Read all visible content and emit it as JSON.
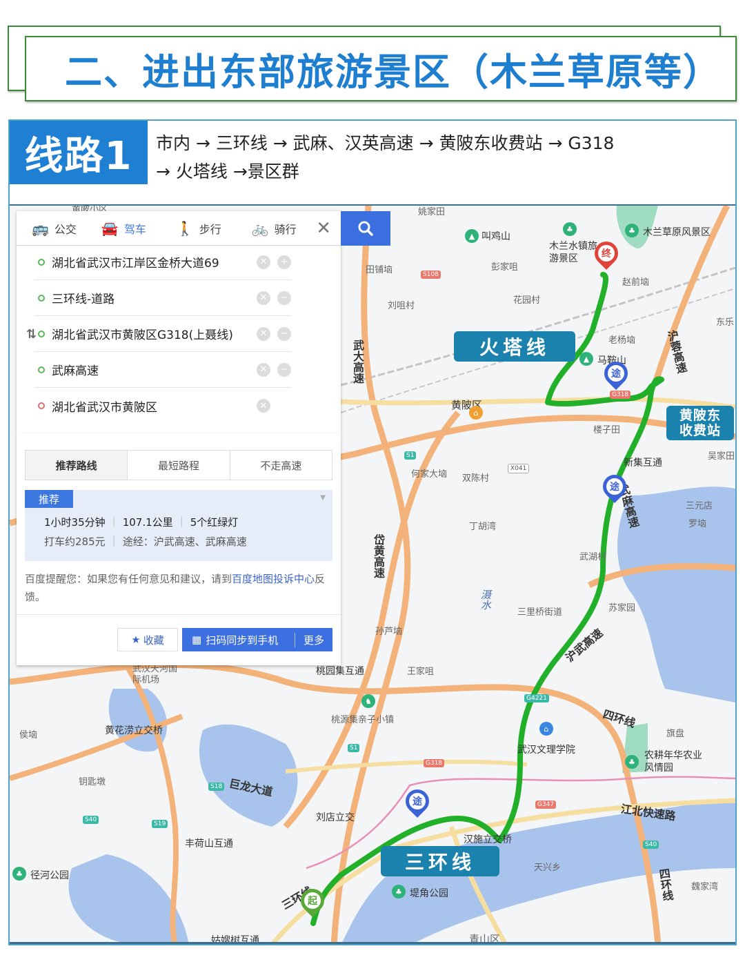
{
  "header": {
    "title": "二、进出东部旅游景区（木兰草原等）"
  },
  "route": {
    "badge": "线路1",
    "description_line1": "市内 → 三环线 → 武麻、汉英高速 → 黄陂东收费站 → G318",
    "description_line2": "→ 火塔线 →景区群"
  },
  "colors": {
    "title_blue": "#1e7fd0",
    "badge_blue": "#1f7fd2",
    "route_green": "#22b02a",
    "callout_teal": "#1a82ad",
    "baidu_blue": "#3c6fe0"
  },
  "directions_panel": {
    "tabs": [
      {
        "label": "公交",
        "icon": "bus-icon"
      },
      {
        "label": "驾车",
        "icon": "car-icon",
        "active": true
      },
      {
        "label": "步行",
        "icon": "walk-icon"
      },
      {
        "label": "骑行",
        "icon": "bike-icon"
      }
    ],
    "waypoints": [
      {
        "text": "湖北省武汉市江岸区金桥大道69",
        "type": "start",
        "action": "add"
      },
      {
        "text": "三环线-道路",
        "type": "via",
        "action": "remove"
      },
      {
        "text": "湖北省武汉市黄陂区G318(上聂线)",
        "type": "via",
        "action": "remove"
      },
      {
        "text": "武麻高速",
        "type": "via",
        "action": "remove"
      },
      {
        "text": "湖北省武汉市黄陂区",
        "type": "end"
      }
    ],
    "preferences": [
      "推荐路线",
      "最短路程",
      "不走高速"
    ],
    "result": {
      "tag": "推荐",
      "duration": "1小时35分钟",
      "distance": "107.1公里",
      "lights": "5个红绿灯",
      "taxi": "打车约285元",
      "via": "途经：沪武高速、武麻高速"
    },
    "notice_prefix": "百度提醒您：如果您有任何意见和建议，请到",
    "notice_link": "百度地图投诉中心",
    "notice_suffix": "反馈。",
    "favorite": "收藏",
    "sync": "扫码同步到手机",
    "more": "更多"
  },
  "map": {
    "callouts": {
      "huota": "火塔线",
      "sanhuan": "三环线",
      "toll": "黄陂东收费站"
    },
    "markers": {
      "end": "终",
      "via": "途",
      "start": "起"
    },
    "places": [
      "黄陂小区",
      "姚家田",
      "叫鸡山",
      "木兰水镇旅游景区",
      "木兰草原风景区",
      "田铺垴",
      "彭家咀",
      "赵前垴",
      "刘咀村",
      "花园村",
      "东乐",
      "老杨垴",
      "马鞍山",
      "黄陂区",
      "楼子田",
      "新集互通",
      "吴家田",
      "何家大垴",
      "双陈村",
      "三元店",
      "罗垴",
      "丁胡湾",
      "武湖村",
      "三里桥街道",
      "苏家园",
      "孙芦垴",
      "王家咀",
      "桃园集互通",
      "武汉天河国际机场",
      "桃源集亲子小镇",
      "黄花涝立交桥",
      "侯垴",
      "钥匙墩",
      "巨龙大道",
      "刘店立交",
      "丰荷山互通",
      "径河公园",
      "姑嫂树互通",
      "武汉文理学院",
      "农耕年华农业风情园",
      "旗盘",
      "汉施立交桥",
      "天兴乡",
      "堤角公园",
      "魏家湾",
      "青山区",
      "江北快速路",
      "四环线",
      "滠水"
    ],
    "roads": {
      "wuda": "武大高速",
      "hurong": "沪蓉高速",
      "wuma": "武麻高速",
      "huangdai": "岱黄高速",
      "huwu": "沪武高速",
      "sihuan": "四环线",
      "sanhuan": "三环线"
    },
    "shields": [
      "S108",
      "G318",
      "S1",
      "X041",
      "G4221",
      "G318",
      "G347",
      "S18",
      "S40",
      "S19",
      "S1",
      "S40"
    ]
  }
}
